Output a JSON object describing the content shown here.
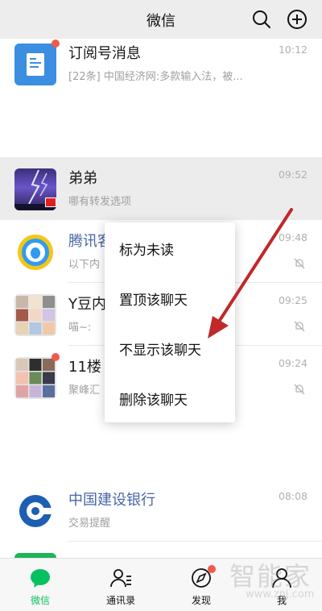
{
  "header": {
    "title": "微信"
  },
  "chats": [
    {
      "name": "订阅号消息",
      "preview": "[22条] 中国经济网:多款输入法，被...",
      "time": "10:12"
    },
    {
      "name": "弟弟",
      "preview": "哪有转发选项",
      "time": "09:52"
    },
    {
      "name": "腾讯客",
      "preview": "以下内",
      "time": "09:48"
    },
    {
      "name": "Y豆内",
      "preview": "喵~:",
      "time": "09:25"
    },
    {
      "name": "11楼",
      "preview": "聚峰汇",
      "time": "09:24"
    },
    {
      "name": "中国建设银行",
      "preview": "交易提醒",
      "time": "08:08"
    }
  ],
  "context_menu": {
    "items": [
      "标为未读",
      "置顶该聊天",
      "不显示该聊天",
      "删除该聊天"
    ]
  },
  "tabbar": {
    "items": [
      "微信",
      "通讯录",
      "发现",
      "我"
    ],
    "active": "微信"
  },
  "watermark": {
    "main": "智能家",
    "sub": "www.znj.com"
  },
  "colors": {
    "accent": "#07c160",
    "badge": "#f05a4a",
    "arrow": "#c0282a",
    "header_bg": "#ededed"
  }
}
